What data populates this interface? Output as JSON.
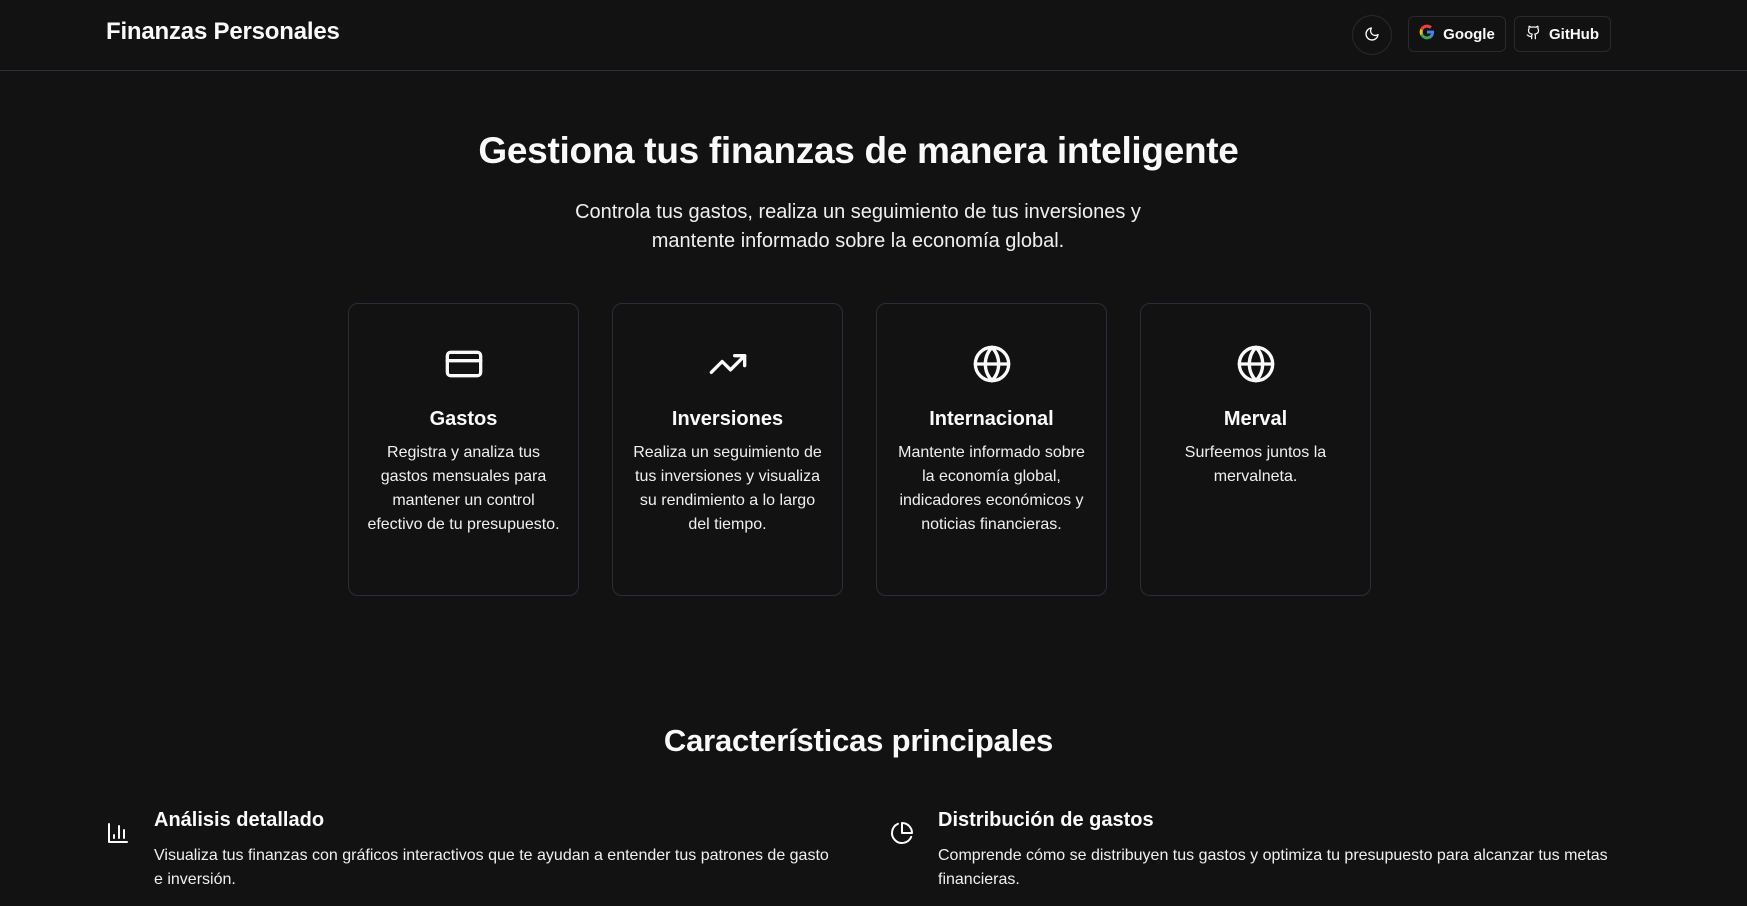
{
  "header": {
    "brand": "Finanzas Personales",
    "theme_toggle_icon": "moon-icon",
    "google_label": "Google",
    "github_label": "GitHub"
  },
  "hero": {
    "title": "Gestiona tus finanzas de manera inteligente",
    "subtitle": "Controla tus gastos, realiza un seguimiento de tus inversiones y mantente informado sobre la economía global."
  },
  "cards": [
    {
      "icon": "credit-card-icon",
      "title": "Gastos",
      "description": "Registra y analiza tus gastos mensuales para mantener un control efectivo de tu presupuesto."
    },
    {
      "icon": "trending-up-icon",
      "title": "Inversiones",
      "description": "Realiza un seguimiento de tus inversiones y visualiza su rendimiento a lo largo del tiempo."
    },
    {
      "icon": "globe-icon",
      "title": "Internacional",
      "description": "Mantente informado sobre la economía global, indicadores económicos y noticias financieras."
    },
    {
      "icon": "globe-icon",
      "title": "Merval",
      "description": "Surfeemos juntos la mervalneta."
    }
  ],
  "features_section": {
    "title": "Características principales",
    "items": [
      {
        "icon": "bar-chart-icon",
        "title": "Análisis detallado",
        "description": "Visualiza tus finanzas con gráficos interactivos que te ayudan a entender tus patrones de gasto e inversión."
      },
      {
        "icon": "pie-chart-icon",
        "title": "Distribución de gastos",
        "description": "Comprende cómo se distribuyen tus gastos y optimiza tu presupuesto para alcanzar tus metas financieras."
      }
    ]
  },
  "colors": {
    "background": "#121212",
    "text": "#fafafa",
    "border": "#2a2e3a"
  }
}
